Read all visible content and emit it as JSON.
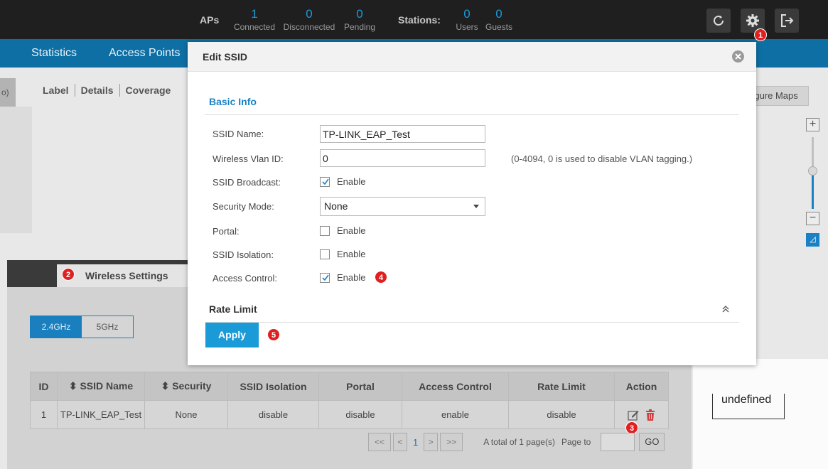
{
  "topbar": {
    "aps_label": "APs",
    "stations_label": "Stations:",
    "stats": [
      {
        "value": "1",
        "label": "Connected"
      },
      {
        "value": "0",
        "label": "Disconnected"
      },
      {
        "value": "0",
        "label": "Pending"
      },
      {
        "value": "0",
        "label": "Users"
      },
      {
        "value": "0",
        "label": "Guests"
      }
    ],
    "icons": [
      "refresh-icon",
      "gear-icon",
      "logout-icon"
    ]
  },
  "nav": {
    "items": [
      "Statistics",
      "Access Points"
    ]
  },
  "background": {
    "left_strip": "o)",
    "tabs": [
      "Label",
      "Details",
      "Coverage"
    ],
    "configure_maps": "Configure Maps",
    "zoom_in": "+",
    "zoom_out": "−",
    "undefined_label": "undefined"
  },
  "wireless": {
    "title": "Wireless Settings",
    "bands": [
      "2.4GHz",
      "5GHz"
    ],
    "active_band": "2.4GHz",
    "columns": [
      "ID",
      "SSID Name",
      "Security",
      "SSID Isolation",
      "Portal",
      "Access Control",
      "Rate Limit",
      "Action"
    ],
    "rows": [
      {
        "id": "1",
        "ssid": "TP-LINK_EAP_Test",
        "security": "None",
        "isolation": "disable",
        "portal": "disable",
        "access_control": "enable",
        "rate_limit": "disable"
      }
    ],
    "pager": {
      "first": "<<",
      "prev": "<",
      "current": "1",
      "next": ">",
      "last": ">>",
      "total": "A total of 1 page(s)",
      "page_to": "Page to",
      "go": "GO"
    }
  },
  "modal": {
    "title": "Edit SSID",
    "basic_info": "Basic Info",
    "fields": {
      "ssid_name_label": "SSID Name:",
      "ssid_name_value": "TP-LINK_EAP_Test",
      "vlan_label": "Wireless Vlan ID:",
      "vlan_value": "0",
      "vlan_hint": "(0-4094, 0 is used to disable VLAN tagging.)",
      "broadcast_label": "SSID Broadcast:",
      "security_label": "Security Mode:",
      "security_value": "None",
      "portal_label": "Portal:",
      "isolation_label": "SSID Isolation:",
      "access_control_label": "Access Control:",
      "enable_text": "Enable"
    },
    "checks": {
      "broadcast": true,
      "portal": false,
      "isolation": false,
      "access_control": true
    },
    "rate_limit": "Rate Limit",
    "apply": "Apply"
  },
  "badges": [
    "1",
    "2",
    "3",
    "4",
    "5"
  ],
  "colors": {
    "accent": "#1a9ad7",
    "nav": "#0d6fa3",
    "topbar": "#1f1f1f",
    "badge": "#e02020"
  }
}
